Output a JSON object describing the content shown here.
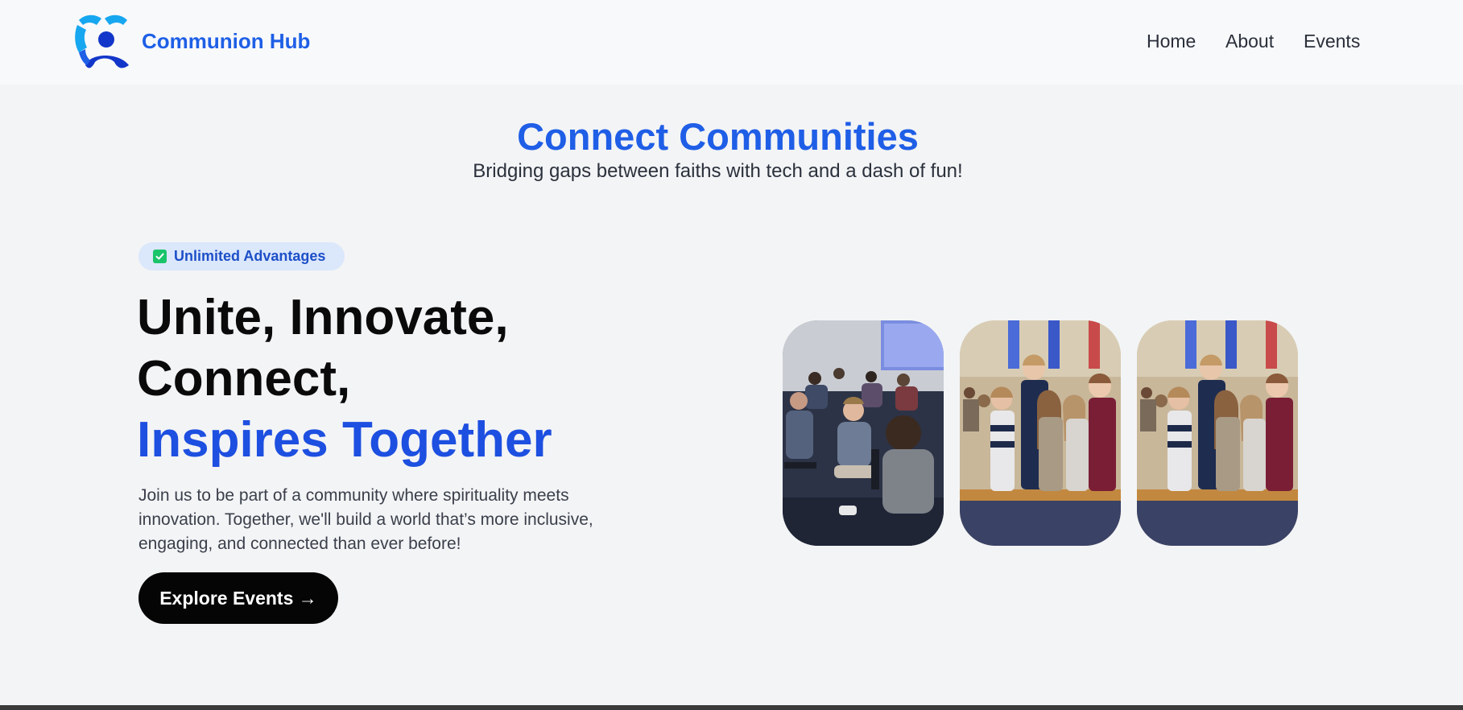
{
  "nav": {
    "brand": "Communion Hub",
    "links": [
      "Home",
      "About",
      "Events"
    ]
  },
  "hero": {
    "title": "Connect Communities",
    "subtitle": "Bridging gaps between faiths with tech and a dash of fun!"
  },
  "main": {
    "badge": "Unlimited Advantages",
    "headline_line1": "Unite, Innovate,",
    "headline_line2": "Connect,",
    "headline_line3": "Inspires Together",
    "description": "Join us to be part of a community where spirituality meets innovation. Together, we'll build a world that’s more inclusive, engaging, and connected than ever before!",
    "cta": "Explore Events →"
  },
  "colors": {
    "brand_blue": "#1e5fe6",
    "logo_light_blue": "#17a7f0",
    "logo_dark_blue": "#1236c9",
    "check_green": "#19c46b",
    "cta_black": "#050505"
  },
  "images": [
    "group-discussion-photo",
    "congregation-standing-photo",
    "congregation-standing-photo"
  ]
}
